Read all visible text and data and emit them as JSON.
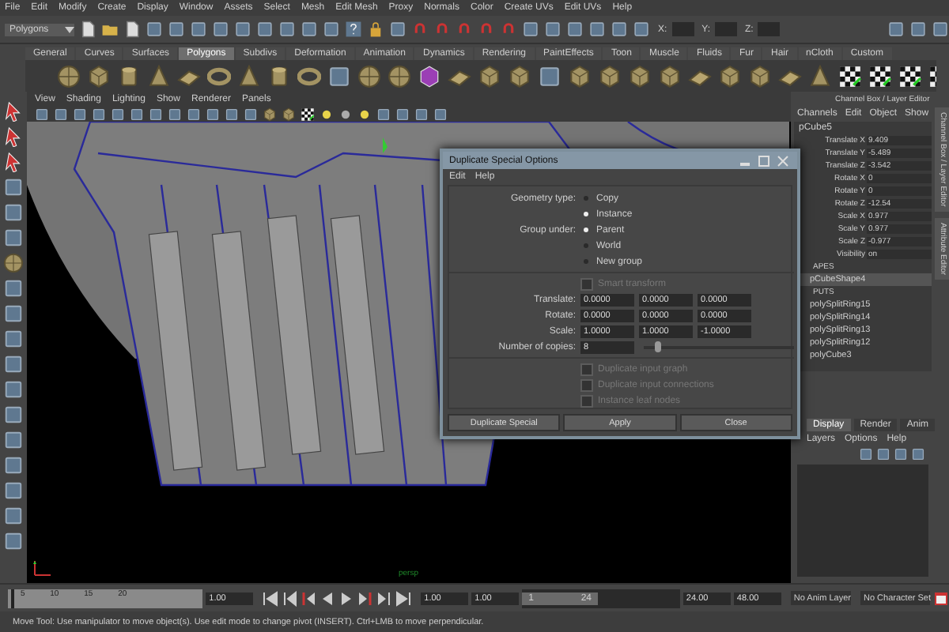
{
  "menu_bar": [
    "File",
    "Edit",
    "Modify",
    "Create",
    "Display",
    "Window",
    "Assets",
    "Select",
    "Mesh",
    "Edit Mesh",
    "Proxy",
    "Normals",
    "Color",
    "Create UVs",
    "Edit UVs",
    "Help"
  ],
  "status_line": {
    "mode_menu": "Polygons",
    "field_labels": [
      "X:",
      "Y:",
      "Z:"
    ]
  },
  "shelf": {
    "tabs": [
      {
        "label": "General",
        "selected": false
      },
      {
        "label": "Curves",
        "selected": false
      },
      {
        "label": "Surfaces",
        "selected": false
      },
      {
        "label": "Polygons",
        "selected": true
      },
      {
        "label": "Subdivs",
        "selected": false
      },
      {
        "label": "Deformation",
        "selected": false
      },
      {
        "label": "Animation",
        "selected": false
      },
      {
        "label": "Dynamics",
        "selected": false
      },
      {
        "label": "Rendering",
        "selected": false
      },
      {
        "label": "PaintEffects",
        "selected": false
      },
      {
        "label": "Toon",
        "selected": false
      },
      {
        "label": "Muscle",
        "selected": false
      },
      {
        "label": "Fluids",
        "selected": false
      },
      {
        "label": "Fur",
        "selected": false
      },
      {
        "label": "Hair",
        "selected": false
      },
      {
        "label": "nCloth",
        "selected": false
      },
      {
        "label": "Custom",
        "selected": false
      }
    ]
  },
  "viewport": {
    "menus": [
      "View",
      "Shading",
      "Lighting",
      "Show",
      "Renderer",
      "Panels"
    ],
    "camera_label": "persp"
  },
  "dialog": {
    "title": "Duplicate Special Options",
    "menus": [
      "Edit",
      "Help"
    ],
    "radio_groups": [
      {
        "label": "Geometry type:",
        "options": [
          {
            "label": "Copy",
            "selected": false
          },
          {
            "label": "Instance",
            "selected": true
          }
        ]
      },
      {
        "label": "Group under:",
        "options": [
          {
            "label": "Parent",
            "selected": true
          },
          {
            "label": "World",
            "selected": false
          },
          {
            "label": "New group",
            "selected": false
          }
        ]
      }
    ],
    "smart_transform": {
      "label": "Smart transform",
      "checked": false,
      "disabled": true
    },
    "vectors": [
      {
        "label": "Translate:",
        "values": [
          "0.0000",
          "0.0000",
          "0.0000"
        ]
      },
      {
        "label": "Rotate:",
        "values": [
          "0.0000",
          "0.0000",
          "0.0000"
        ]
      },
      {
        "label": "Scale:",
        "values": [
          "1.0000",
          "1.0000",
          "-1.0000"
        ]
      }
    ],
    "copies": {
      "label": "Number of copies:",
      "value": "8",
      "level": 0.07
    },
    "options": [
      {
        "label": "Duplicate input graph",
        "checked": false,
        "disabled": true
      },
      {
        "label": "Duplicate input connections",
        "checked": false,
        "disabled": true
      },
      {
        "label": "Instance leaf nodes",
        "checked": false,
        "disabled": true
      }
    ],
    "buttons": [
      "Duplicate Special",
      "Apply",
      "Close"
    ]
  },
  "channel_box": {
    "title": "Channel Box / Layer Editor",
    "menus": [
      "Channels",
      "Edit",
      "Object",
      "Show"
    ],
    "object": "pCube5",
    "attributes": [
      {
        "name": "Translate X",
        "value": "9.409"
      },
      {
        "name": "Translate Y",
        "value": "-5.489"
      },
      {
        "name": "Translate Z",
        "value": "-3.542"
      },
      {
        "name": "Rotate X",
        "value": "0"
      },
      {
        "name": "Rotate Y",
        "value": "0"
      },
      {
        "name": "Rotate Z",
        "value": "-12.54"
      },
      {
        "name": "Scale X",
        "value": "0.977"
      },
      {
        "name": "Scale Y",
        "value": "0.977"
      },
      {
        "name": "Scale Z",
        "value": "-0.977"
      },
      {
        "name": "Visibility",
        "value": "on"
      }
    ],
    "nodes": [
      {
        "kind": "header",
        "label": "APES"
      },
      {
        "kind": "item",
        "label": "pCubeShape4"
      },
      {
        "kind": "header",
        "label": "PUTS"
      },
      {
        "kind": "item",
        "label": "polySplitRing15"
      },
      {
        "kind": "item",
        "label": "polySplitRing14"
      },
      {
        "kind": "item",
        "label": "polySplitRing13"
      },
      {
        "kind": "item",
        "label": "polySplitRing12"
      },
      {
        "kind": "item",
        "label": "polyCube3"
      }
    ]
  },
  "side_tabs": [
    "Channel Box / Layer Editor",
    "Attribute Editor"
  ],
  "layer_editor": {
    "tabs": [
      {
        "label": "Display",
        "selected": true
      },
      {
        "label": "Render",
        "selected": false
      },
      {
        "label": "Anim",
        "selected": false
      }
    ],
    "menus": [
      "Layers",
      "Options",
      "Help"
    ]
  },
  "time_slider": {
    "ticks": [
      "5",
      "10",
      "15",
      "20"
    ],
    "current_time": "1.00",
    "level": 0.02
  },
  "range_slider": {
    "start_time": "1.00",
    "range_start_field": "1.00",
    "range_start": "1",
    "range_end": "24",
    "range_end_field": "24.00",
    "end_time": "48.00",
    "level": 0.48
  },
  "anim_layer": "No Anim Layer",
  "character_set": "No Character Set",
  "help_line": "Move Tool: Use manipulator to move object(s). Use edit mode to change pivot (INSERT).  Ctrl+LMB to move perpendicular."
}
